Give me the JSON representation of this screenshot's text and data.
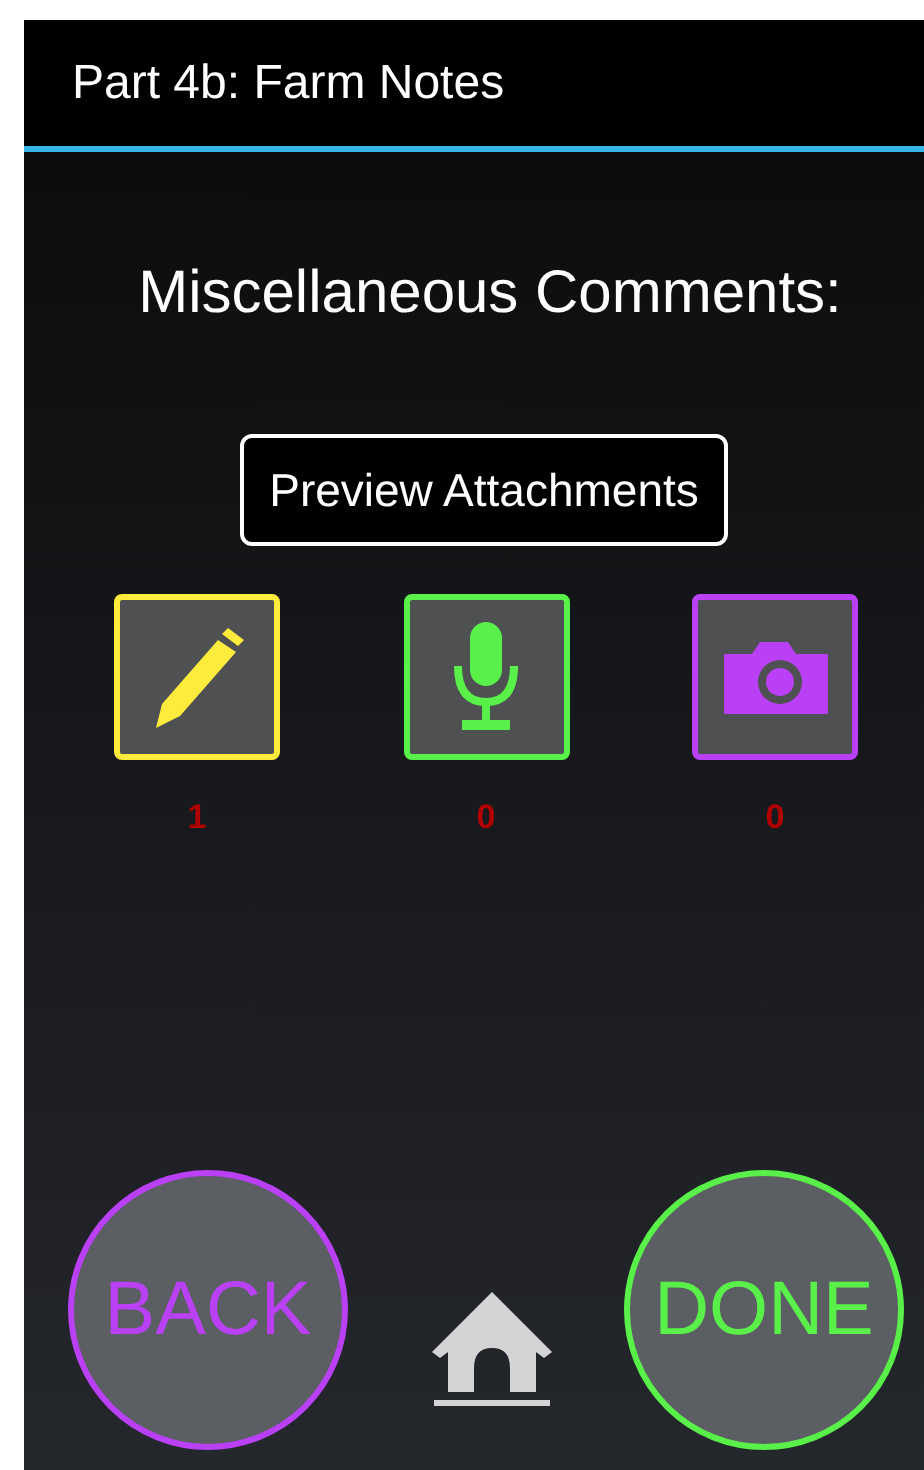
{
  "title": "Part 4b: Farm Notes",
  "heading": "Miscellaneous Comments:",
  "preview_button": "Preview Attachments",
  "attachments": [
    {
      "kind": "note",
      "color": "#ffeb3b",
      "count": "1"
    },
    {
      "kind": "audio",
      "color": "#5af04a",
      "count": "0"
    },
    {
      "kind": "photo",
      "color": "#b940f5",
      "count": "0"
    }
  ],
  "back_button": {
    "label": "BACK",
    "color": "#b940f5"
  },
  "done_button": {
    "label": "DONE",
    "color": "#5af04a"
  }
}
